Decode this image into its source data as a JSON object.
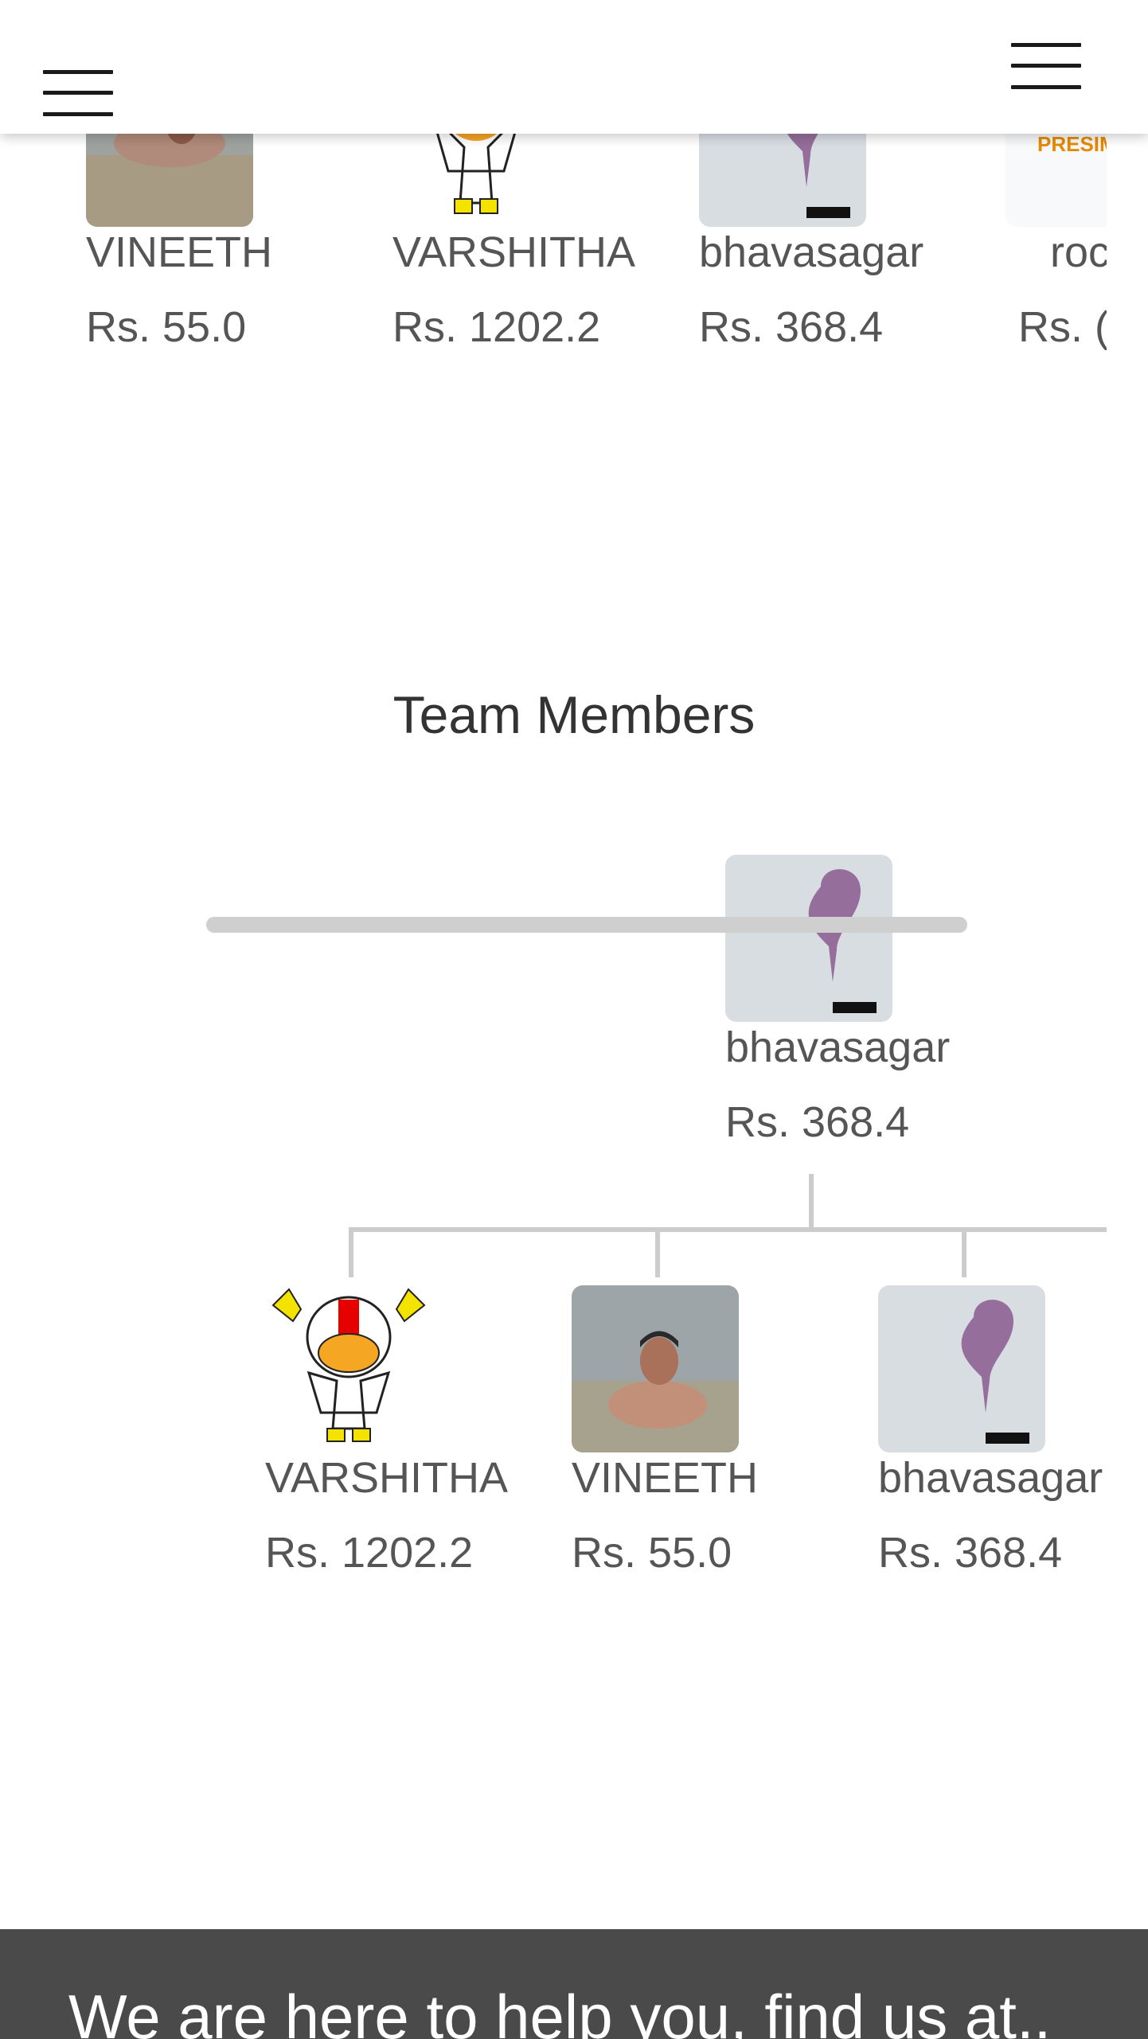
{
  "top_row": [
    {
      "name": "VINEETH",
      "amount": "Rs. 55.0"
    },
    {
      "name": "VARSHITHA",
      "amount": "Rs. 1202.2"
    },
    {
      "name": "bhavasagar",
      "amount": "Rs. 368.4"
    },
    {
      "name": "roc",
      "amount": "Rs. (",
      "logo_text": "PRESIM"
    }
  ],
  "team": {
    "title": "Team Members",
    "root": {
      "name": "bhavasagar",
      "amount": "Rs. 368.4"
    },
    "children": [
      {
        "name": "VARSHITHA",
        "amount": "Rs. 1202.2"
      },
      {
        "name": "VINEETH",
        "amount": "Rs. 55.0"
      },
      {
        "name": "bhavasagar",
        "amount": "Rs. 368.4"
      }
    ]
  },
  "footer": {
    "text": "We are here to help you, find us at.."
  },
  "colors": {
    "text": "#555555",
    "footer_bg": "#4a4a4a",
    "connector": "#cccccc",
    "scrollbar": "#cfcfcf"
  }
}
